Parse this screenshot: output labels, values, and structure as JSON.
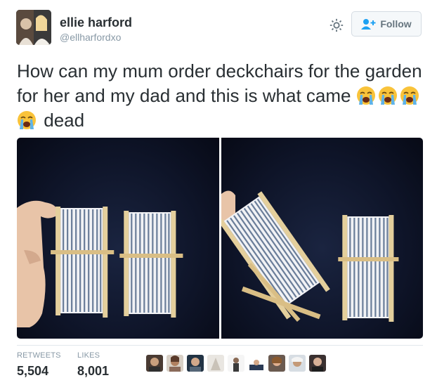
{
  "user": {
    "name": "ellie harford",
    "handle": "@ellharfordxo"
  },
  "follow_button": {
    "label": "Follow"
  },
  "tweet": {
    "text_main": "How can my mum order deckchairs for the garden for her and my dad and this is what came",
    "text_end": "dead",
    "emoji": [
      "loudly-crying-face-icon",
      "loudly-crying-face-icon",
      "loudly-crying-face-icon",
      "loudly-crying-face-icon"
    ]
  },
  "stats": {
    "retweets_label": "RETWEETS",
    "retweets_value": "5,504",
    "likes_label": "LIKES",
    "likes_value": "8,001"
  },
  "likers_count_shown": 9,
  "colors": {
    "name": "#292f33",
    "handle": "#8899a6",
    "follow_icon": "#1da1f2",
    "photo_bg": "#0e1428"
  }
}
